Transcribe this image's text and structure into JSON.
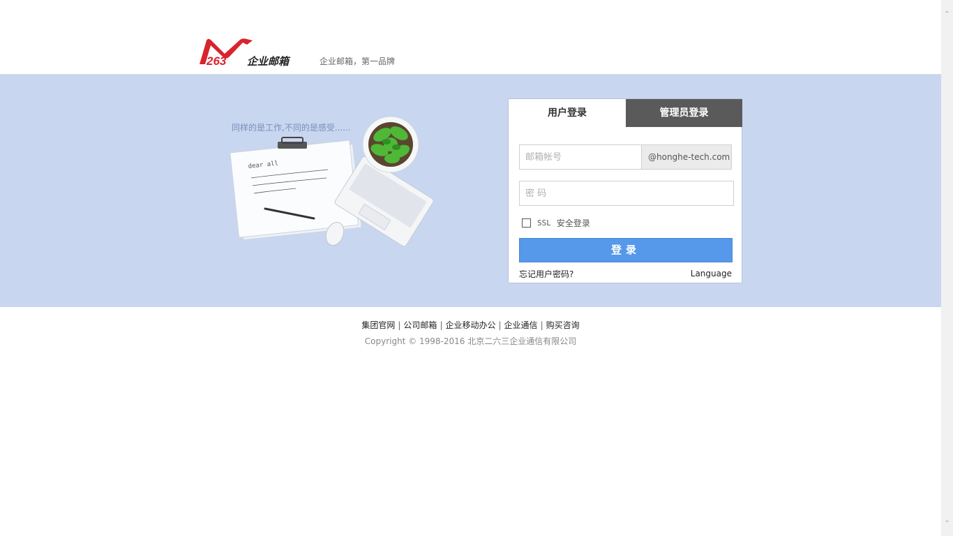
{
  "header": {
    "logo_text": "263企业邮箱",
    "slogan": "企业邮箱，第一品牌"
  },
  "banner": {
    "tagline": "同样的是工作,不同的是感受......",
    "note_greeting": "dear all"
  },
  "login": {
    "tabs": [
      {
        "label": "用户登录",
        "active": true
      },
      {
        "label": "管理员登录",
        "active": false
      }
    ],
    "email_placeholder": "邮箱帐号",
    "domain": "@honghe-tech.com",
    "password_placeholder": "密 码",
    "ssl_prefix": "SSL",
    "ssl_label": "安全登录",
    "ssl_checked": false,
    "submit_label": "登录",
    "forgot_label": "忘记用户密码?",
    "language_label": "Language"
  },
  "footer": {
    "links": [
      "集团官网",
      "公司邮箱",
      "企业移动办公",
      "企业通信",
      "购买咨询"
    ],
    "copyright": "Copyright © 1998-2016 北京二六三企业通信有限公司"
  },
  "colors": {
    "banner_bg": "#c8d6f0",
    "login_button": "#5698e9",
    "admin_tab": "#5a5a5a",
    "logo_red": "#d9232d"
  }
}
